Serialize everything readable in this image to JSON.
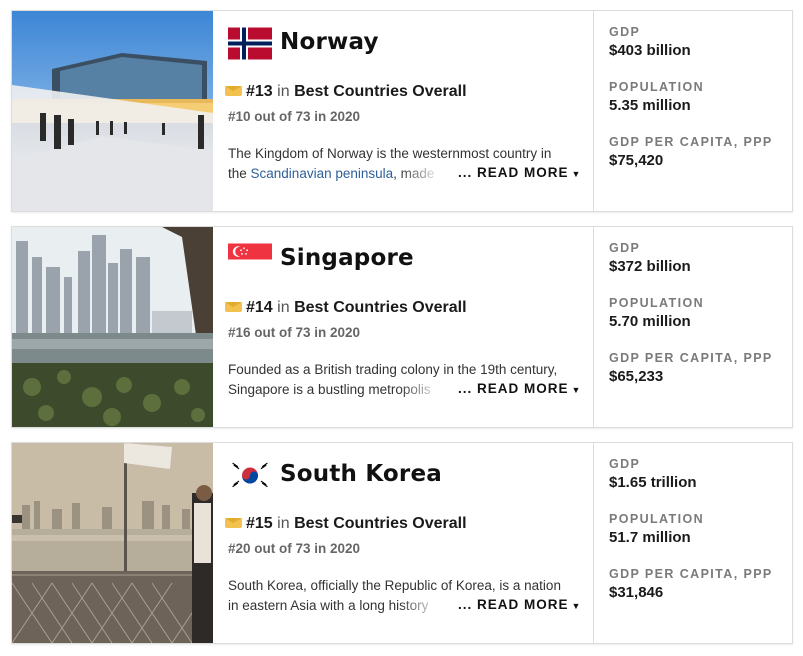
{
  "countries": [
    {
      "name": "Norway",
      "flag_icon": "norway-flag-icon",
      "photo": "oslo-opera-house-photo",
      "rank": "#13",
      "rank_in": "in",
      "rank_list": "Best Countries Overall",
      "previous": "#10 out of 73 in 2020",
      "desc_line1": "The Kingdom of Norway is the westernmost country in",
      "desc_line2_pre": "the ",
      "desc_line2_link": "Scandinavian peninsula",
      "desc_line2_post": ", made",
      "read_more": "... READ MORE",
      "stats": [
        {
          "label": "GDP",
          "value": "$403 billion"
        },
        {
          "label": "POPULATION",
          "value": "5.35 million"
        },
        {
          "label": "GDP PER CAPITA, PPP",
          "value": "$75,420"
        }
      ]
    },
    {
      "name": "Singapore",
      "flag_icon": "singapore-flag-icon",
      "photo": "singapore-skyline-photo",
      "rank": "#14",
      "rank_in": "in",
      "rank_list": "Best Countries Overall",
      "previous": "#16 out of 73 in 2020",
      "desc_line1": "Founded as a British trading colony in the 19th century,",
      "desc_line2_pre": "Singapore is a bustling metropolis",
      "desc_line2_link": "",
      "desc_line2_post": "",
      "read_more": "... READ MORE",
      "stats": [
        {
          "label": "GDP",
          "value": "$372 billion"
        },
        {
          "label": "POPULATION",
          "value": "5.70 million"
        },
        {
          "label": "GDP PER CAPITA, PPP",
          "value": "$65,233"
        }
      ]
    },
    {
      "name": "South Korea",
      "flag_icon": "south-korea-flag-icon",
      "photo": "han-river-seoul-photo",
      "rank": "#15",
      "rank_in": "in",
      "rank_list": "Best Countries Overall",
      "previous": "#20 out of 73 in 2020",
      "desc_line1": "South Korea, officially the Republic of Korea, is a nation",
      "desc_line2_pre": "in eastern Asia with a long history",
      "desc_line2_link": "",
      "desc_line2_post": "",
      "read_more": "... READ MORE",
      "stats": [
        {
          "label": "GDP",
          "value": "$1.65 trillion"
        },
        {
          "label": "POPULATION",
          "value": "51.7 million"
        },
        {
          "label": "GDP PER CAPITA, PPP",
          "value": "$31,846"
        }
      ]
    }
  ],
  "colors": {
    "medal": "#f2c14e",
    "link": "#2f5f9a",
    "label_gray": "#7a7a7a",
    "border": "#dcdcdc"
  }
}
